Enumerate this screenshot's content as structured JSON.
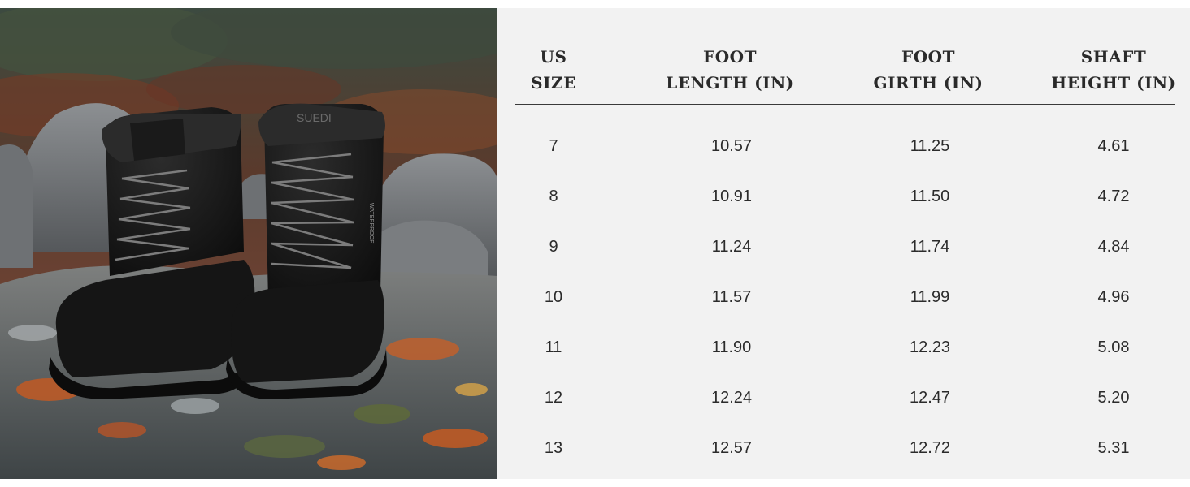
{
  "product": {
    "brand_mark": "SUEDI",
    "tongue_label": "WATERPROOF"
  },
  "table": {
    "headers": [
      {
        "line1": "US",
        "line2": "SIZE"
      },
      {
        "line1": "FOOT",
        "line2": "LENGTH (IN)"
      },
      {
        "line1": "FOOT",
        "line2": "GIRTH (IN)"
      },
      {
        "line1": "SHAFT",
        "line2": "HEIGHT (IN)"
      }
    ],
    "rows": [
      [
        "7",
        "10.57",
        "11.25",
        "4.61"
      ],
      [
        "8",
        "10.91",
        "11.50",
        "4.72"
      ],
      [
        "9",
        "11.24",
        "11.74",
        "4.84"
      ],
      [
        "10",
        "11.57",
        "11.99",
        "4.96"
      ],
      [
        "11",
        "11.90",
        "12.23",
        "5.08"
      ],
      [
        "12",
        "12.24",
        "12.47",
        "5.20"
      ],
      [
        "13",
        "12.57",
        "12.72",
        "5.31"
      ]
    ]
  }
}
